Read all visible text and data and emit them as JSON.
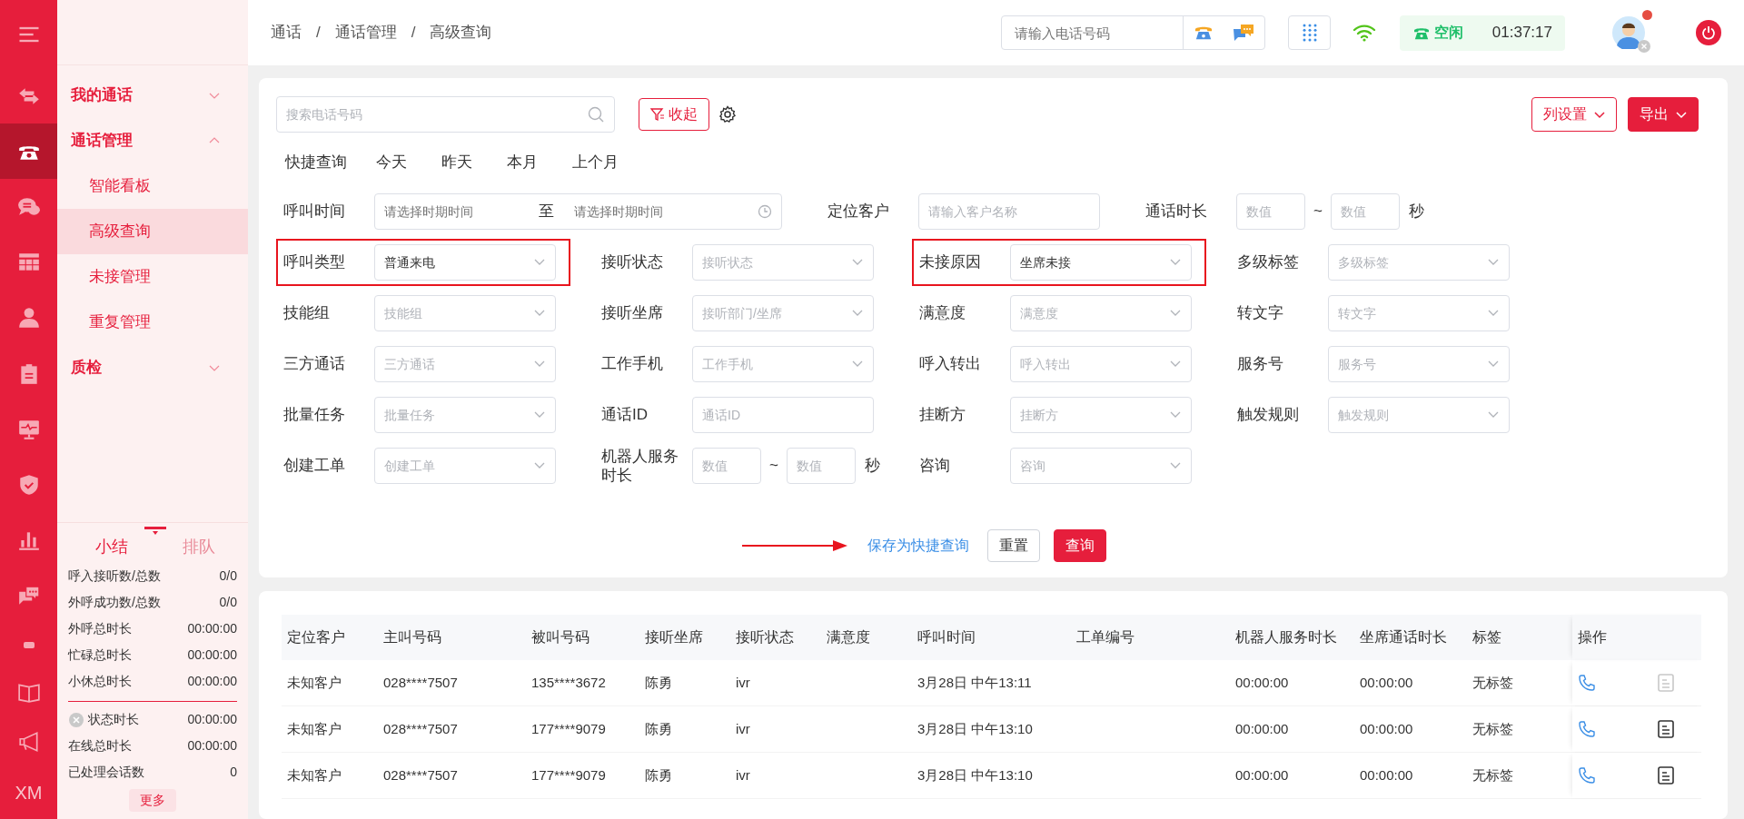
{
  "rail": {
    "items": [
      {
        "selected": false
      },
      {
        "selected": false
      },
      {
        "selected": true
      },
      {
        "selected": false
      },
      {
        "selected": false
      },
      {
        "selected": false
      },
      {
        "selected": false
      },
      {
        "selected": false
      },
      {
        "selected": false
      },
      {
        "selected": false
      },
      {
        "selected": false
      },
      {
        "selected": false
      },
      {
        "selected": false
      },
      {
        "selected": false
      },
      {
        "text": "XM",
        "selected": false
      }
    ]
  },
  "nav": {
    "groups": [
      {
        "label": "我的通话",
        "expanded": false
      },
      {
        "label": "通话管理",
        "expanded": true,
        "children": [
          {
            "label": "智能看板",
            "selected": false
          },
          {
            "label": "高级查询",
            "selected": true
          },
          {
            "label": "未接管理",
            "selected": false
          },
          {
            "label": "重复管理",
            "selected": false
          }
        ]
      },
      {
        "label": "质检",
        "expanded": false
      }
    ]
  },
  "summary": {
    "tabs": [
      {
        "label": "小结",
        "selected": true
      },
      {
        "label": "排队",
        "selected": false
      }
    ],
    "stats": [
      {
        "label": "呼入接听数/总数",
        "value": "0/0"
      },
      {
        "label": "外呼成功数/总数",
        "value": "0/0"
      },
      {
        "label": "外呼总时长",
        "value": "00:00:00"
      },
      {
        "label": "忙碌总时长",
        "value": "00:00:00"
      },
      {
        "label": "小休总时长",
        "value": "00:00:00"
      }
    ],
    "status_stats": [
      {
        "kind": "status",
        "label": "状态时长",
        "value": "00:00:00"
      },
      {
        "kind": "plain",
        "label": "在线总时长",
        "value": "00:00:00"
      },
      {
        "kind": "plain",
        "label": "已处理会话数",
        "value": "0"
      }
    ],
    "more_button": "更多"
  },
  "breadcrumb": {
    "items": [
      "通话",
      "通话管理",
      "高级查询"
    ],
    "separator": "/"
  },
  "header": {
    "phone_placeholder": "请输入电话号码",
    "status": {
      "label": "空闲",
      "time": "01:37:17"
    },
    "avatar": {
      "notification": true
    }
  },
  "filter": {
    "search_placeholder": "搜索电话号码",
    "collapse_button": "收起",
    "column_settings": "列设置",
    "export": "导出",
    "quick_query": {
      "label": "快捷查询",
      "options": [
        "今天",
        "昨天",
        "本月",
        "上个月"
      ]
    },
    "first_row": [
      {
        "kind": "date_range",
        "label": "呼叫时间",
        "placeholders": [
          "请选择时期时间",
          "请选择时期时间"
        ],
        "separator": "至",
        "highlighted": false
      },
      {
        "kind": "text",
        "label": "定位客户",
        "placeholder": "请输入客户名称",
        "highlighted": false
      },
      {
        "kind": "number_range",
        "label": "通话时长",
        "placeholders": [
          "数值",
          "数值"
        ],
        "separator": "~",
        "unit": "秒",
        "highlighted": false
      }
    ],
    "rows": [
      [
        {
          "kind": "select",
          "label": "呼叫类型",
          "value": "普通来电",
          "highlighted": true
        },
        {
          "kind": "select",
          "label": "接听状态",
          "placeholder": "接听状态",
          "highlighted": false
        },
        {
          "kind": "select",
          "label": "未接原因",
          "value": "坐席未接",
          "highlighted": true
        },
        {
          "kind": "select",
          "label": "多级标签",
          "placeholder": "多级标签",
          "highlighted": false
        }
      ],
      [
        {
          "kind": "select",
          "label": "技能组",
          "placeholder": "技能组",
          "highlighted": false
        },
        {
          "kind": "select",
          "label": "接听坐席",
          "placeholder": "接听部门/坐席",
          "highlighted": false
        },
        {
          "kind": "select",
          "label": "满意度",
          "placeholder": "满意度",
          "highlighted": false
        },
        {
          "kind": "select",
          "label": "转文字",
          "placeholder": "转文字",
          "highlighted": false
        }
      ],
      [
        {
          "kind": "select",
          "label": "三方通话",
          "placeholder": "三方通话",
          "highlighted": false
        },
        {
          "kind": "select",
          "label": "工作手机",
          "placeholder": "工作手机",
          "highlighted": false
        },
        {
          "kind": "select",
          "label": "呼入转出",
          "placeholder": "呼入转出",
          "highlighted": false
        },
        {
          "kind": "select",
          "label": "服务号",
          "placeholder": "服务号",
          "highlighted": false
        }
      ],
      [
        {
          "kind": "select",
          "label": "批量任务",
          "placeholder": "批量任务",
          "highlighted": false
        },
        {
          "kind": "text",
          "label": "通话ID",
          "placeholder": "通话ID",
          "highlighted": false
        },
        {
          "kind": "select",
          "label": "挂断方",
          "placeholder": "挂断方",
          "highlighted": false
        },
        {
          "kind": "select",
          "label": "触发规则",
          "placeholder": "触发规则",
          "highlighted": false
        }
      ],
      [
        {
          "kind": "select",
          "label": "创建工单",
          "placeholder": "创建工单",
          "highlighted": false
        },
        {
          "kind": "number_range",
          "label": "机器人服务时长",
          "placeholders": [
            "数值",
            "数值"
          ],
          "separator": "~",
          "unit": "秒",
          "highlighted": false
        },
        {
          "kind": "select",
          "label": "咨询",
          "placeholder": "咨询",
          "highlighted": false
        }
      ]
    ],
    "actions": {
      "save_quick": "保存为快捷查询",
      "reset": "重置",
      "search": "查询"
    },
    "annotation": {
      "arrow": true
    }
  },
  "table": {
    "columns": [
      "定位客户",
      "主叫号码",
      "被叫号码",
      "接听坐席",
      "接听状态",
      "满意度",
      "呼叫时间",
      "工单编号",
      "机器人服务时长",
      "坐席通话时长",
      "标签"
    ],
    "action_column": "操作",
    "rows": [
      {
        "cells": [
          "未知客户",
          "028****7507",
          "135****3672",
          "陈勇",
          "ivr",
          "",
          "3月28日 中午13:11",
          "",
          "00:00:00",
          "00:00:00",
          "无标签"
        ],
        "detail_enabled": false
      },
      {
        "cells": [
          "未知客户",
          "028****7507",
          "177****9079",
          "陈勇",
          "ivr",
          "",
          "3月28日 中午13:10",
          "",
          "00:00:00",
          "00:00:00",
          "无标签"
        ],
        "detail_enabled": true
      },
      {
        "cells": [
          "未知客户",
          "028****7507",
          "177****9079",
          "陈勇",
          "ivr",
          "",
          "3月28日 中午13:10",
          "",
          "00:00:00",
          "00:00:00",
          "无标签"
        ],
        "detail_enabled": true
      }
    ]
  }
}
